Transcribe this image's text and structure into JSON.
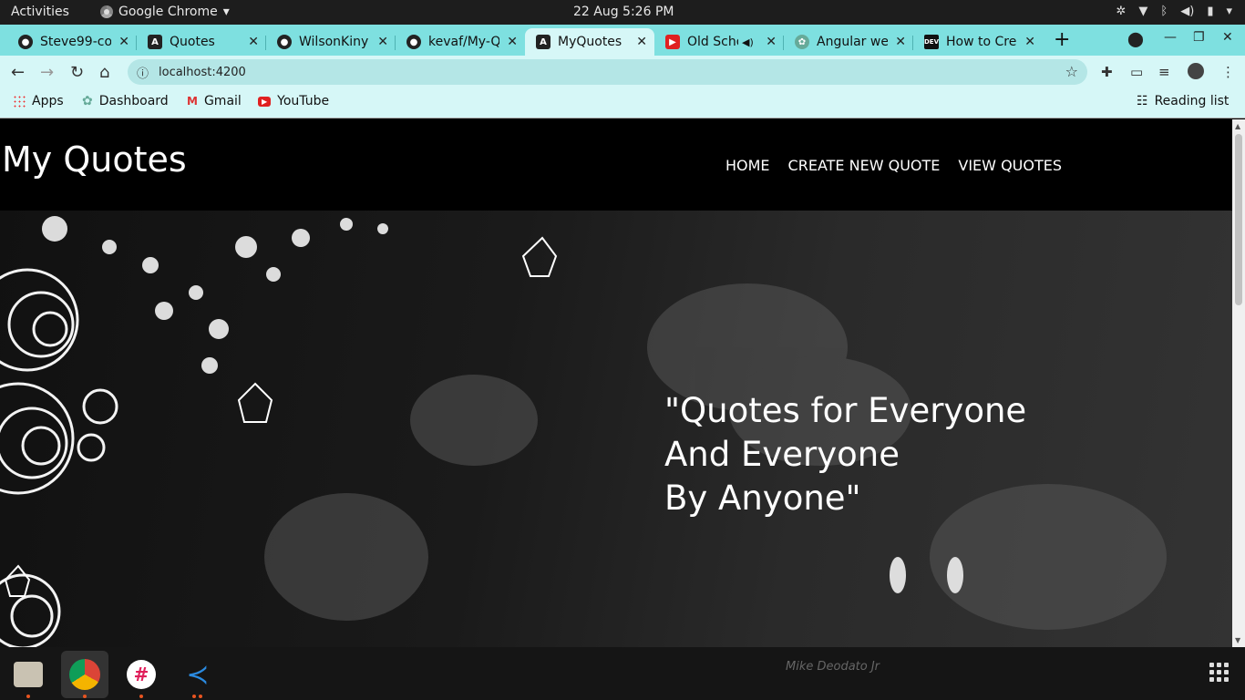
{
  "system": {
    "activities": "Activities",
    "app_name": "Google Chrome",
    "clock": "22 Aug   5:26 PM"
  },
  "tabs": [
    {
      "title": "Steve99-coo",
      "icon": "github-icon"
    },
    {
      "title": "Quotes",
      "icon": "angular-icon"
    },
    {
      "title": "WilsonKiny",
      "icon": "github-icon"
    },
    {
      "title": "kevaf/My-Q",
      "icon": "github-icon"
    },
    {
      "title": "MyQuotes",
      "icon": "angular-icon"
    },
    {
      "title": "Old Scho",
      "icon": "youtube-icon"
    },
    {
      "title": "Angular we",
      "icon": "leaf-icon"
    },
    {
      "title": "How to Cre",
      "icon": "dev-icon"
    }
  ],
  "toolbar": {
    "url": "localhost:4200"
  },
  "bookmarks": {
    "apps": "Apps",
    "dashboard": "Dashboard",
    "gmail": "Gmail",
    "youtube": "YouTube",
    "reading_list": "Reading list"
  },
  "site": {
    "brand": "My Quotes",
    "nav": {
      "home": "HOME",
      "create": "CREATE NEW QUOTE",
      "view": "VIEW QUOTES"
    },
    "slogan_line1": "\"Quotes for Everyone",
    "slogan_line2": "And Everyone",
    "slogan_line3": "By Anyone\""
  },
  "dock": {
    "signature": "Mike Deodato Jr"
  },
  "colors": {
    "tab_strip": "#7ee0e0",
    "active_tab": "#d6f7f7",
    "site_bg": "#000000",
    "dock_accent": "#e95420"
  }
}
